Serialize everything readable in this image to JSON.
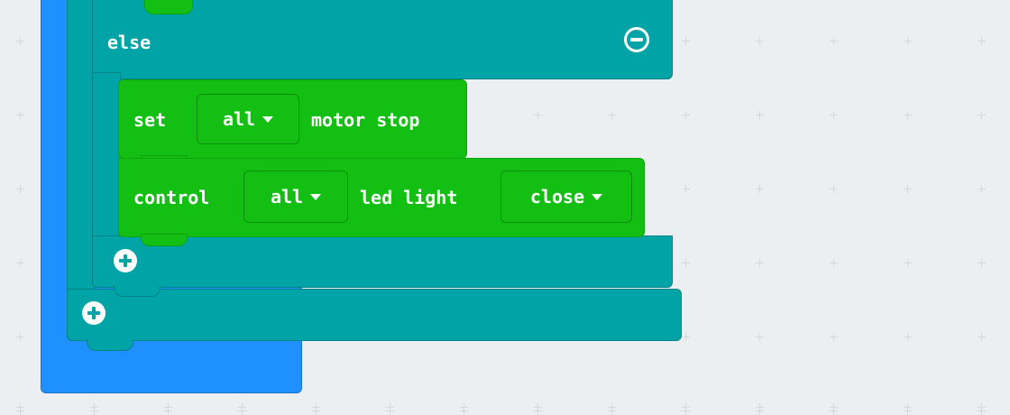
{
  "workspace": {
    "else_label": "else",
    "set_block": {
      "prefix": "set",
      "target_value": "all",
      "suffix": "motor stop"
    },
    "control_block": {
      "prefix": "control",
      "target_value": "all",
      "middle": "led light",
      "state_value": "close"
    }
  },
  "colors": {
    "workspace_bg": "#ebeff2",
    "event_block": "#1e90ff",
    "logic_block": "#00a4a6",
    "robot_block": "#13bf13"
  },
  "icons": {
    "remove_else": "minus-circle-icon",
    "add_else_if": "plus-circle-icon",
    "add_outer": "plus-circle-icon",
    "dropdown": "caret-down-icon"
  }
}
